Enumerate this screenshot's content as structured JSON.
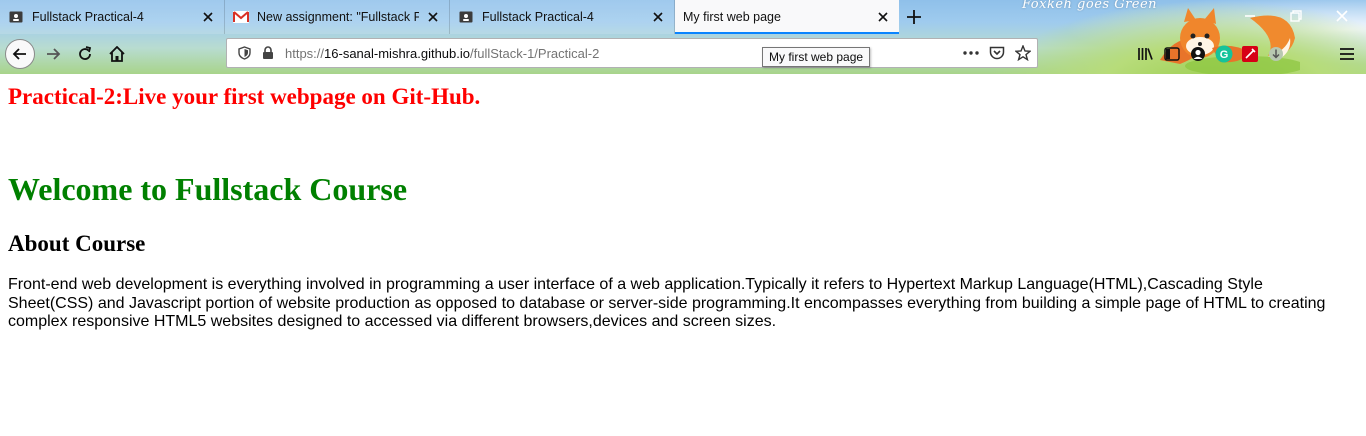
{
  "browser": {
    "tabs": [
      {
        "title": "Fullstack Practical-4",
        "favicon": "classroom-icon",
        "active": false
      },
      {
        "title": "New assignment: \"Fullstack Pra",
        "favicon": "gmail-icon",
        "active": false
      },
      {
        "title": "Fullstack Practical-4",
        "favicon": "classroom-icon",
        "active": false
      },
      {
        "title": "My first web page",
        "favicon": "none",
        "active": true
      }
    ],
    "theme_text": "Foxkeh goes Green",
    "url": {
      "prefix": "https://",
      "domain": "16-sanal-mishra.github.io",
      "path": "/fullStack-1/Practical-2"
    },
    "tooltip": "My first web page",
    "accent_color": "#0a84ff"
  },
  "page": {
    "heading_red": "Practical-2:Live your first webpage on Git-Hub.",
    "heading_green": "Welcome to Fullstack Course",
    "heading_about": "About Course",
    "paragraph": "Front-end web development is everything involved in programming a user interface of a web application.Typically it refers to Hypertext Markup Language(HTML),Cascading Style Sheet(CSS) and Javascript portion of website production as opposed to database or server-side programming.It encompasses everything from building a simple page of HTML to creating complex responsive HTML5 websites designed to accessed via different browsers,devices and screen sizes.",
    "colors": {
      "heading_red": "#ff0000",
      "heading_green": "#008000",
      "text": "#000000"
    }
  }
}
